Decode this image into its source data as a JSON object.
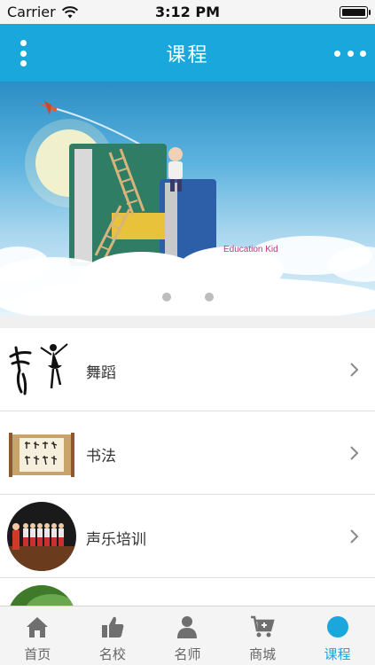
{
  "status_bar": {
    "carrier": "Carrier",
    "time": "3:12 PM",
    "battery_level": 1.0,
    "wifi_icon": "wifi-icon",
    "battery_icon": "battery-icon"
  },
  "header": {
    "title": "课程",
    "left_icon": "vertical-dots-icon",
    "right_icon": "more-dots-icon",
    "background_color": "#19a7dc"
  },
  "banner": {
    "caption": "Education Kid",
    "slide_count": 3,
    "active_slide": 2
  },
  "courses": [
    {
      "label": "舞蹈",
      "thumbnail": "dance-calligraphy-image"
    },
    {
      "label": "书法",
      "thumbnail": "calligraphy-scroll-image"
    },
    {
      "label": "声乐培训",
      "thumbnail": "choir-performance-image"
    },
    {
      "label": "",
      "thumbnail": "green-course-image"
    }
  ],
  "tabs": [
    {
      "label": "首页",
      "icon": "home-icon",
      "active": false
    },
    {
      "label": "名校",
      "icon": "thumbs-up-icon",
      "active": false
    },
    {
      "label": "名师",
      "icon": "person-icon",
      "active": false
    },
    {
      "label": "商城",
      "icon": "cart-icon",
      "active": false
    },
    {
      "label": "课程",
      "icon": "circle-icon",
      "active": true
    }
  ],
  "colors": {
    "accent": "#19a7dc",
    "tab_inactive": "#666666"
  }
}
